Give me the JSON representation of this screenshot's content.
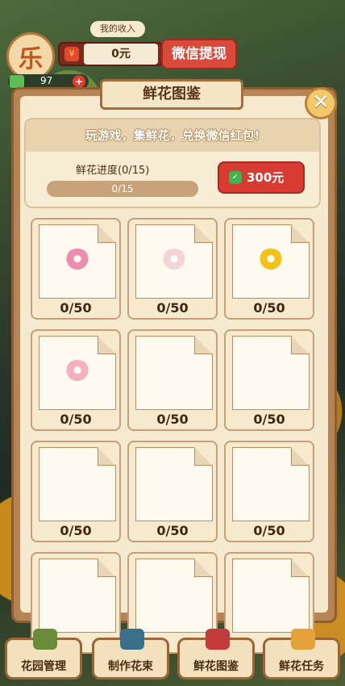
{
  "hud": {
    "avatar_char": "乐",
    "income_label": "我的收入",
    "income_value": "0元",
    "withdraw_label": "微信提现",
    "cash_value": "97"
  },
  "panel": {
    "title": "鲜花图鉴",
    "slogan": "玩游戏，集鲜花，兑换微信红包!",
    "progress_label": "鲜花进度(0/15)",
    "progress_text": "0/15",
    "progress_fraction": 0,
    "reward_label": "300元"
  },
  "flowers": [
    {
      "count": "0/50",
      "icon": "pink-peony-icon",
      "color": "#f08cae"
    },
    {
      "count": "0/50",
      "icon": "white-peony-icon",
      "color": "#f3d5d9"
    },
    {
      "count": "0/50",
      "icon": "chrysanthemum-icon",
      "color": "#f2c21b"
    },
    {
      "count": "0/50",
      "icon": "pink-lotus-icon",
      "color": "#f4b1bd"
    },
    {
      "count": "0/50",
      "icon": "",
      "color": ""
    },
    {
      "count": "0/50",
      "icon": "",
      "color": ""
    },
    {
      "count": "0/50",
      "icon": "",
      "color": ""
    },
    {
      "count": "0/50",
      "icon": "",
      "color": ""
    },
    {
      "count": "0/50",
      "icon": "",
      "color": ""
    },
    {
      "count": "",
      "icon": "",
      "color": ""
    },
    {
      "count": "",
      "icon": "",
      "color": ""
    },
    {
      "count": "",
      "icon": "",
      "color": ""
    }
  ],
  "nav": [
    {
      "label": "花园管理",
      "icon": "garden-icon",
      "color": "#6a8c3a"
    },
    {
      "label": "制作花束",
      "icon": "bouquet-icon",
      "color": "#3a6f8c"
    },
    {
      "label": "鲜花图鉴",
      "icon": "book-icon",
      "color": "#c23a3a"
    },
    {
      "label": "鲜花任务",
      "icon": "envelope-icon",
      "color": "#e5a23a"
    }
  ]
}
